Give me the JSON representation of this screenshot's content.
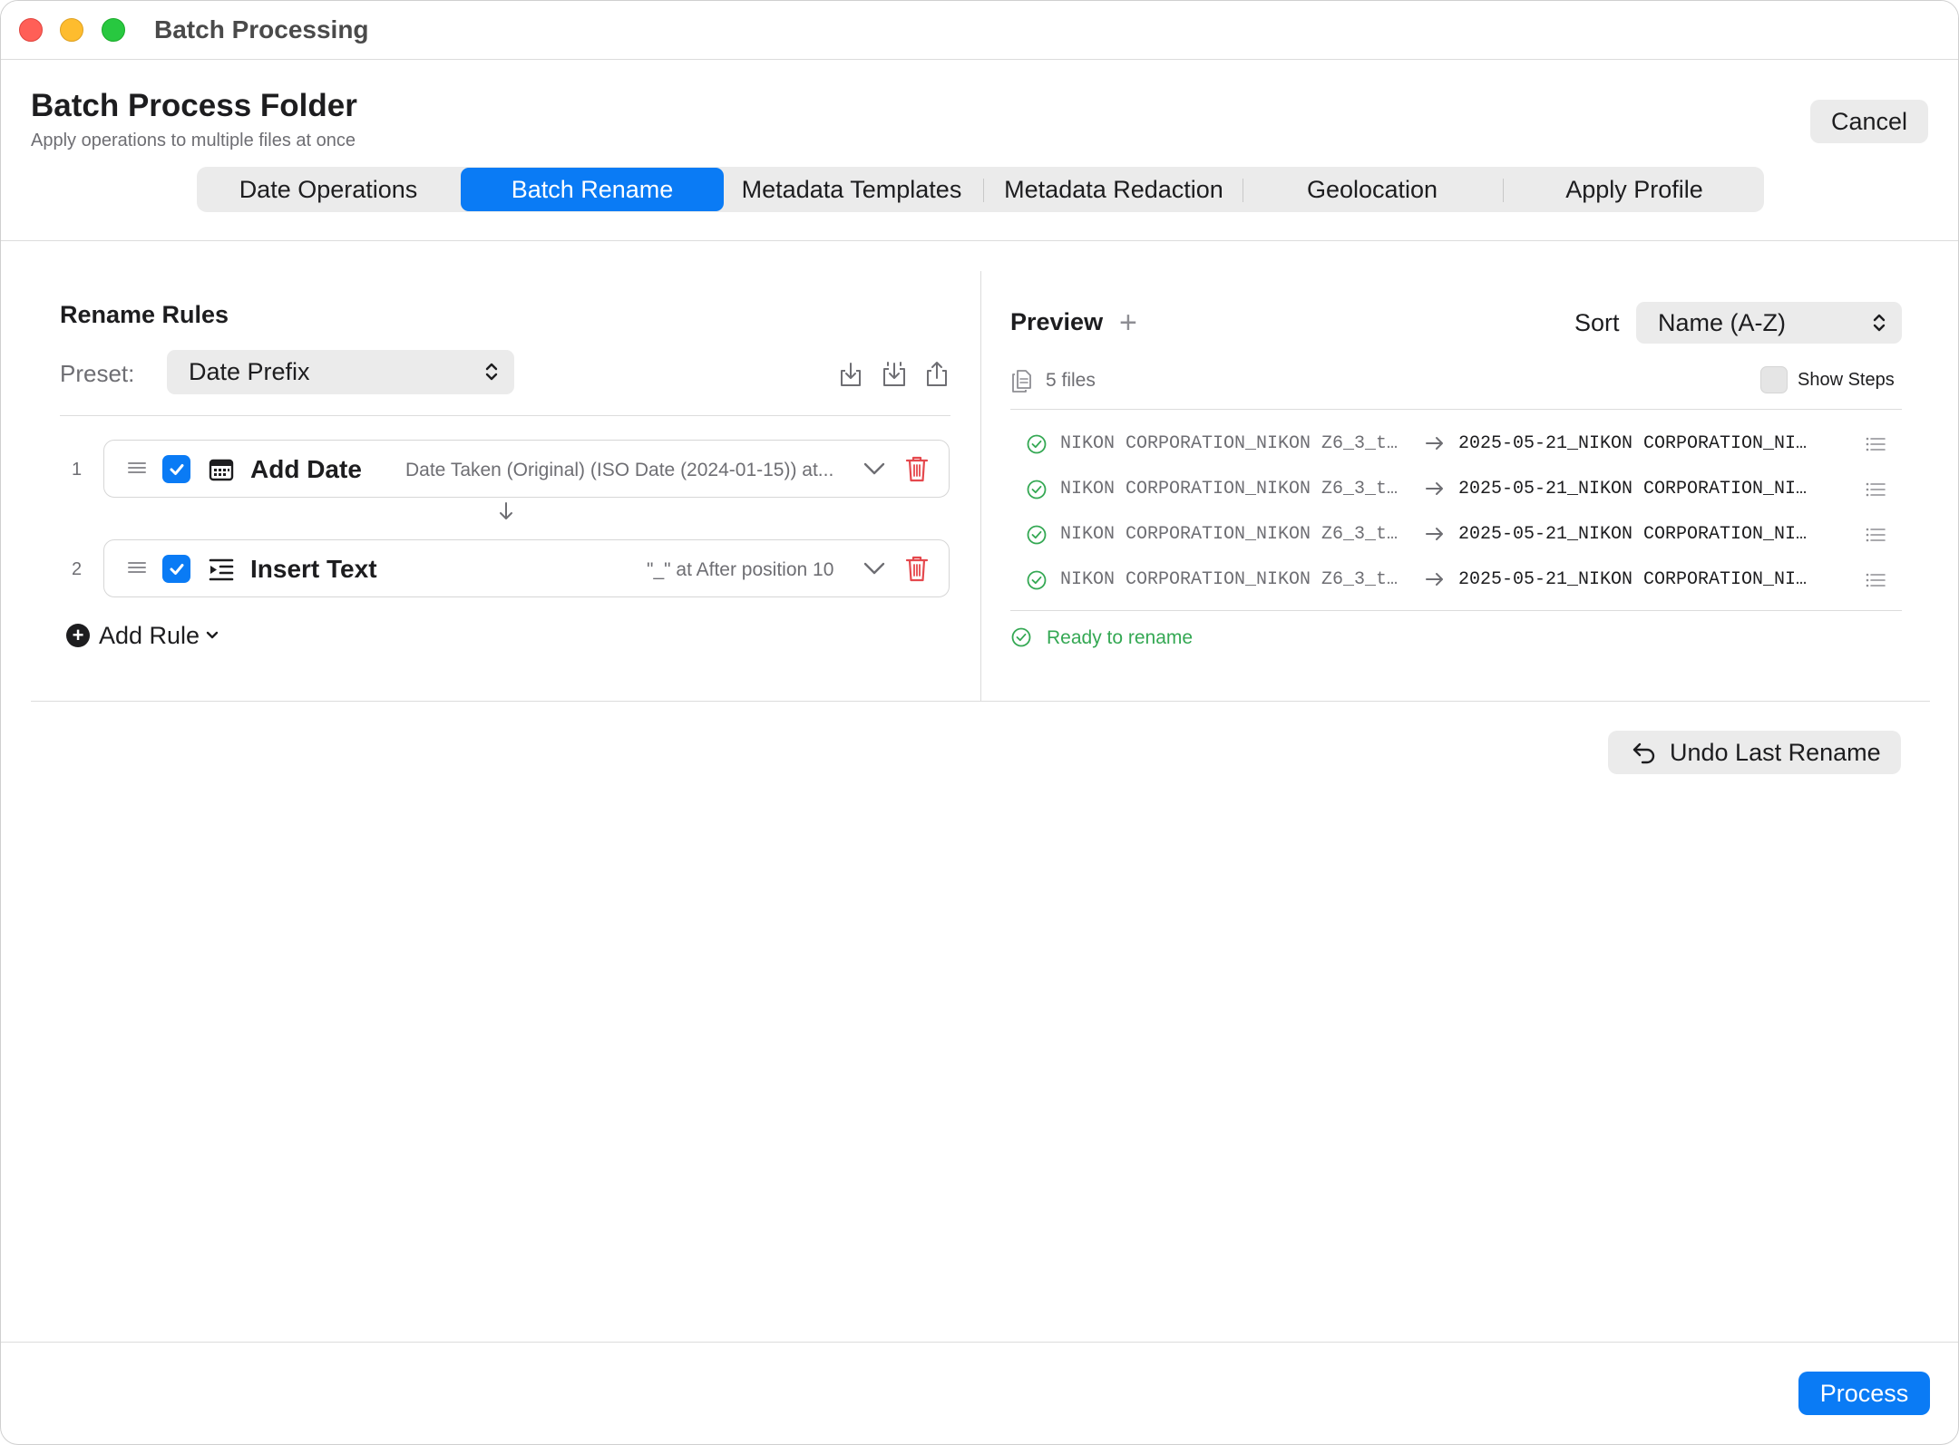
{
  "window": {
    "title": "Batch Processing"
  },
  "header": {
    "title": "Batch Process Folder",
    "subtitle": "Apply operations to multiple files at once",
    "cancel_label": "Cancel"
  },
  "tabs": [
    {
      "label": "Date Operations",
      "active": false
    },
    {
      "label": "Batch Rename",
      "active": true
    },
    {
      "label": "Metadata Templates",
      "active": false
    },
    {
      "label": "Metadata Redaction",
      "active": false
    },
    {
      "label": "Geolocation",
      "active": false
    },
    {
      "label": "Apply Profile",
      "active": false
    }
  ],
  "rules_panel": {
    "title": "Rename Rules",
    "preset_label": "Preset:",
    "preset_value": "Date Prefix",
    "rules": [
      {
        "number": "1",
        "name": "Add Date",
        "icon": "calendar-icon",
        "enabled": true,
        "description": "Date Taken (Original) (ISO Date (2024-01-15)) at..."
      },
      {
        "number": "2",
        "name": "Insert Text",
        "icon": "insert-text-icon",
        "enabled": true,
        "description": "\"_\" at After position 10"
      }
    ],
    "add_rule_label": "Add Rule"
  },
  "preview_panel": {
    "title": "Preview",
    "sort_label": "Sort",
    "sort_value": "Name (A-Z)",
    "file_count": "5 files",
    "show_steps_label": "Show Steps",
    "show_steps_checked": false,
    "files": [
      {
        "original": "NIKON CORPORATION_NIKON Z6_3_t…",
        "renamed": "2025-05-21_NIKON CORPORATION_NI…"
      },
      {
        "original": "NIKON CORPORATION_NIKON Z6_3_t…",
        "renamed": "2025-05-21_NIKON CORPORATION_NI…"
      },
      {
        "original": "NIKON CORPORATION_NIKON Z6_3_t…",
        "renamed": "2025-05-21_NIKON CORPORATION_NI…"
      },
      {
        "original": "NIKON CORPORATION_NIKON Z6_3_t…",
        "renamed": "2025-05-21_NIKON CORPORATION_NI…"
      }
    ],
    "status": "Ready to rename"
  },
  "actions": {
    "undo_label": "Undo Last Rename",
    "process_label": "Process"
  },
  "colors": {
    "accent": "#0a7bf5",
    "success": "#34a853",
    "destructive": "#e5484d"
  }
}
